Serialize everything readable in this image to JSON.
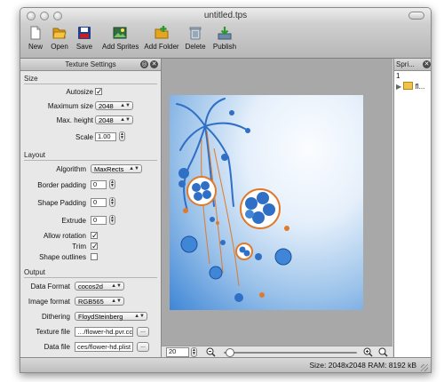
{
  "window": {
    "title": "untitled.tps"
  },
  "toolbar": {
    "new": "New",
    "open": "Open",
    "save": "Save",
    "add_sprites": "Add Sprites",
    "add_folder": "Add Folder",
    "delete": "Delete",
    "publish": "Publish"
  },
  "texture_panel": {
    "title": "Texture Settings",
    "size": {
      "section": "Size",
      "autosize_label": "Autosize",
      "autosize_checked": true,
      "max_size_label": "Maximum size",
      "max_size": "2048",
      "max_height_label": "Max. height",
      "max_height": "2048",
      "scale_label": "Scale",
      "scale": "1.00"
    },
    "layout": {
      "section": "Layout",
      "algorithm_label": "Algorithm",
      "algorithm": "MaxRects",
      "border_padding_label": "Border padding",
      "border_padding": "0",
      "shape_padding_label": "Shape Padding",
      "shape_padding": "0",
      "extrude_label": "Extrude",
      "extrude": "0",
      "allow_rotation_label": "Allow rotation",
      "allow_rotation_checked": true,
      "trim_label": "Trim",
      "trim_checked": true,
      "shape_outlines_label": "Shape outlines",
      "shape_outlines_checked": false
    },
    "output": {
      "section": "Output",
      "data_format_label": "Data Format",
      "data_format": "cocos2d",
      "image_format_label": "Image format",
      "image_format": "RGB565",
      "dithering_label": "Dithering",
      "dithering": "FloydSteinberg",
      "texture_file_label": "Texture file",
      "texture_file": "…/flower-hd.pvr.ccz",
      "data_file_label": "Data file",
      "data_file": "ces/flower-hd.plist",
      "browse_label": "..."
    }
  },
  "sprites_panel": {
    "title": "Spri...",
    "count": "1",
    "item": "fl..."
  },
  "zoom": {
    "value": "20"
  },
  "status": {
    "text": "Size: 2048x2048 RAM: 8192 kB"
  },
  "colors": {
    "accent": "#2f6fc6",
    "orange": "#e07a2a"
  }
}
